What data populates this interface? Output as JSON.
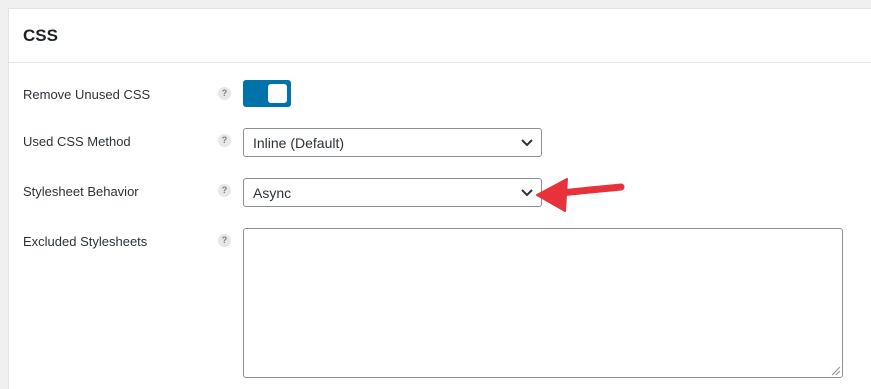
{
  "section": {
    "title": "CSS"
  },
  "rows": [
    {
      "label": "Remove Unused CSS",
      "help": "?"
    },
    {
      "label": "Used CSS Method",
      "help": "?"
    },
    {
      "label": "Stylesheet Behavior",
      "help": "?"
    },
    {
      "label": "Excluded Stylesheets",
      "help": "?"
    }
  ],
  "controls": {
    "remove_unused_css": {
      "type": "toggle",
      "enabled": true
    },
    "used_css_method": {
      "selected": "Inline (Default)"
    },
    "stylesheet_behavior": {
      "selected": "Async"
    },
    "excluded_stylesheets": {
      "value": ""
    }
  },
  "icons": {
    "help": "help-icon",
    "dropdown": "chevron-down-icon",
    "resize": "resize-grip-icon",
    "annotation": "red-arrow-icon"
  },
  "colors": {
    "toggle_on": "#0073aa",
    "annotation_arrow": "#e8323a"
  }
}
